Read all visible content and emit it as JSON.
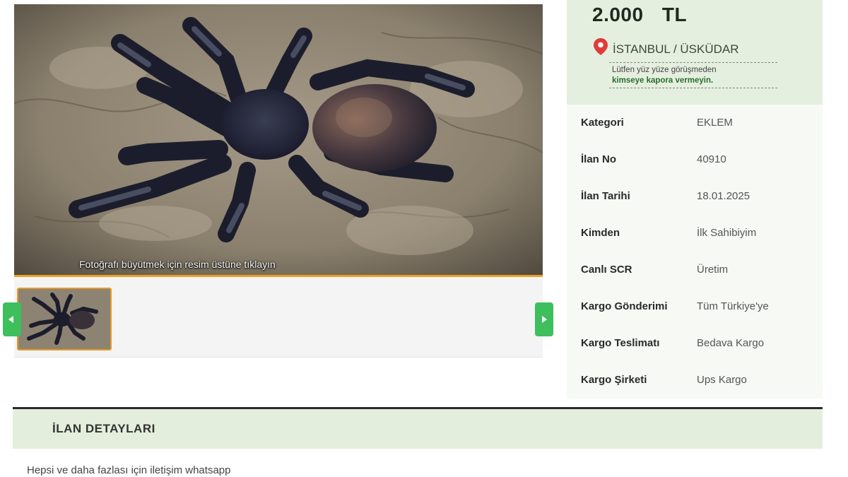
{
  "listing": {
    "price": "2.000 TL",
    "location": "İSTANBUL / ÜSKÜDAR",
    "warning_line1": "Lütfen yüz yüze görüşmeden",
    "warning_line2": "kimseye kapora vermeyin.",
    "photo_caption": "Fotoğrafı büyütmek için resim üstüne tıklayın"
  },
  "details": [
    {
      "label": "Kategori",
      "value": "EKLEM"
    },
    {
      "label": "İlan No",
      "value": "40910"
    },
    {
      "label": "İlan Tarihi",
      "value": "18.01.2025"
    },
    {
      "label": "Kimden",
      "value": "İlk Sahibiyim"
    },
    {
      "label": "Canlı SCR",
      "value": "Üretim"
    },
    {
      "label": "Kargo Gönderimi",
      "value": "Tüm Türkiye'ye"
    },
    {
      "label": "Kargo Teslimatı",
      "value": "Bedava Kargo"
    },
    {
      "label": "Kargo Şirketi",
      "value": "Ups Kargo"
    }
  ],
  "section": {
    "title": "İLAN DETAYLARI",
    "description": "Hepsi ve daha fazlası için iletişim whatsapp"
  },
  "icons": {
    "location": "map-pin-icon",
    "prev": "chevron-left-icon",
    "next": "chevron-right-icon"
  },
  "colors": {
    "accent_green": "#3dbf5c",
    "price_panel_bg": "#e5efdf",
    "thumb_border": "#e69a2a",
    "pin": "#e23a3a"
  }
}
